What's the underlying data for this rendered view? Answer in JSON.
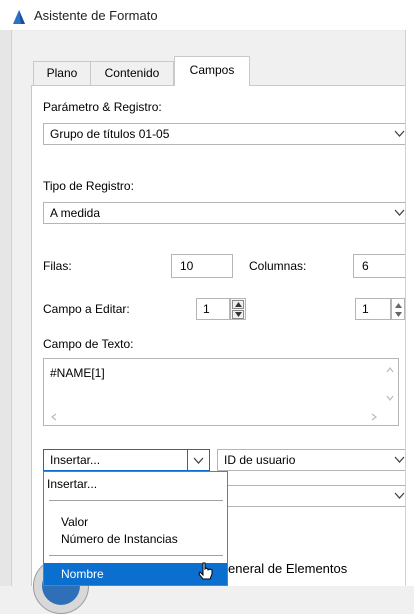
{
  "window": {
    "title": "Asistente de Formato"
  },
  "tabs": [
    {
      "label": "Plano",
      "active": false
    },
    {
      "label": "Contenido",
      "active": false
    },
    {
      "label": "Campos",
      "active": true
    }
  ],
  "parametro": {
    "label": "Parámetro & Registro:",
    "value": "Grupo de títulos 01-05"
  },
  "tipo": {
    "label": "Tipo de Registro:",
    "value": "A medida"
  },
  "filas": {
    "label": "Filas:",
    "value": "10"
  },
  "columnas": {
    "label": "Columnas:",
    "value": "6"
  },
  "campo_editar": {
    "label": "Campo a Editar:",
    "value1": "1",
    "value2": "1"
  },
  "campo_texto": {
    "label": "Campo de Texto:",
    "value": "#NAME[1]"
  },
  "insertar": {
    "value": "Insertar...",
    "id_usuario": "ID de usuario"
  },
  "dropdown": {
    "items": [
      "Insertar...",
      "Valor",
      "Número de Instancias",
      "Nombre"
    ],
    "highlighted": "Nombre"
  },
  "bottom": {
    "label": "eneral de Elementos"
  },
  "colors": {
    "accent": "#0b6fcf",
    "logo": "#2a72c8"
  },
  "icons": [
    "chevron-down-icon",
    "spin-up-icon",
    "spin-down-icon",
    "scroll-arrow-icon",
    "mouse-cursor-icon"
  ]
}
